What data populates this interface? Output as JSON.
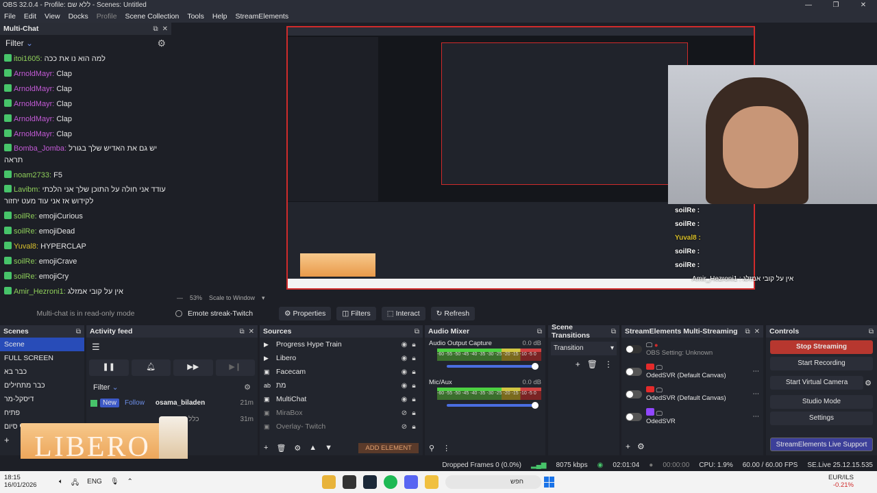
{
  "window": {
    "title": "OBS 32.0.4 - Profile: ללא שם - Scenes: Untitled"
  },
  "menu": [
    "File",
    "Edit",
    "View",
    "Docks",
    "Profile",
    "Scene Collection",
    "Tools",
    "Help",
    "StreamElements"
  ],
  "multichat": {
    "title": "Multi-Chat",
    "filter_label": "Filter",
    "readonly_note": "Multi-chat is in read-only mode",
    "messages": [
      {
        "user": "itoi1605:",
        "text": "למה הוא נו את ככה",
        "color": "#8fcf5a"
      },
      {
        "user": "ArnoldMayr:",
        "text": "Clap",
        "color": "#c35ad6"
      },
      {
        "user": "ArnoldMayr:",
        "text": "Clap",
        "color": "#c35ad6"
      },
      {
        "user": "ArnoldMayr:",
        "text": "Clap",
        "color": "#c35ad6"
      },
      {
        "user": "ArnoldMayr:",
        "text": "Clap",
        "color": "#c35ad6"
      },
      {
        "user": "ArnoldMayr:",
        "text": "Clap",
        "color": "#c35ad6"
      },
      {
        "user": "Bomba_Jomba:",
        "text": "יש גם את האדיש שלך בגורל תראה",
        "color": "#c35ad6"
      },
      {
        "user": "noam2733:",
        "text": "F5",
        "color": "#8fcf5a"
      },
      {
        "user": "Lavibm:",
        "text": "עודד אני חולה על התוכן שלך אני הלכתי לקידוש אז אני עוד מעט יחזור",
        "color": "#8fcf5a"
      },
      {
        "user": "soilRe:",
        "text": "emojiCurious",
        "color": "#8fcf5a"
      },
      {
        "user": "soilRe:",
        "text": "emojiDead",
        "color": "#8fcf5a"
      },
      {
        "user": "Yuval8:",
        "text": "HYPERCLAP",
        "color": "#d9c02c"
      },
      {
        "user": "soilRe:",
        "text": "emojiCrave",
        "color": "#8fcf5a"
      },
      {
        "user": "soilRe:",
        "text": "emojiCry",
        "color": "#8fcf5a"
      },
      {
        "user": "Amir_Hezroni1:",
        "text": "אין על קובי אמזלג",
        "color": "#8fcf5a"
      }
    ]
  },
  "preview": {
    "zoom": "53%",
    "scale_mode": "Scale to Window",
    "source_name": "Emote streak-Twitch",
    "buttons": {
      "properties": "Properties",
      "filters": "Filters",
      "interact": "Interact",
      "refresh": "Refresh"
    }
  },
  "overlay_chat": {
    "lines": [
      "soilRe :",
      "soilRe :",
      "Yuval8 :",
      "soilRe :",
      "soilRe :"
    ],
    "last": "Amir_Hezroni1 : אין על קובי אמזלג"
  },
  "scenes": {
    "title": "Scenes",
    "items": [
      "Scene",
      "FULL SCREEN",
      "כבר בא",
      "כבר מתחילים",
      "דיסקל-מר",
      "פתיח",
      "סוף סיום"
    ]
  },
  "activity": {
    "title": "Activity feed",
    "filter_label": "Filter",
    "event": {
      "tag_new": "New",
      "tag_type": "Follow",
      "user": "osama_biladen",
      "time": "21m"
    },
    "event2_time": "31m",
    "event2_text": "כלל שאינ"
  },
  "sources": {
    "title": "Sources",
    "items": [
      {
        "name": "Progress Hype Train",
        "dim": false
      },
      {
        "name": "Libero",
        "dim": false
      },
      {
        "name": "Facecam",
        "dim": false
      },
      {
        "name": "מת",
        "dim": false
      },
      {
        "name": "MultiChat",
        "dim": false
      },
      {
        "name": "MiraBox",
        "dim": true
      },
      {
        "name": "Overlay- Twitch",
        "dim": true
      }
    ],
    "add_element": "ADD ELEMENT"
  },
  "audio": {
    "title": "Audio Mixer",
    "channels": [
      {
        "name": "Audio Output Capture",
        "db": "0.0 dB",
        "scale": "-60 -55 -50 -45 -40 -35 -30 -25 -20 -15 -10 -5 0"
      },
      {
        "name": "Mic/Aux",
        "db": "0.0 dB",
        "scale": "-60 -55 -50 -45 -40 -35 -30 -25 -20 -15 -10 -5 0"
      }
    ]
  },
  "transitions": {
    "title": "Scene Transitions",
    "selected": "Transition"
  },
  "multistream": {
    "title": "StreamElements Multi-Streaming",
    "rows": [
      {
        "label": "OBS Setting: Unknown",
        "platform": "obs"
      },
      {
        "label": "OdedSVR (Default Canvas)",
        "platform": "youtube"
      },
      {
        "label": "OdedSVR (Default Canvas)",
        "platform": "youtube"
      },
      {
        "label": "OdedSVR",
        "platform": "twitch"
      }
    ]
  },
  "controls": {
    "title": "Controls",
    "buttons": [
      "Stop Streaming",
      "Start Recording",
      "Start Virtual Camera",
      "Studio Mode",
      "Settings"
    ],
    "live_support": "StreamElements Live Support"
  },
  "status": {
    "dropped": "Dropped Frames 0 (0.0%)",
    "bitrate": "8075 kbps",
    "stream_time": "02:01:04",
    "rec_time": "00:00:00",
    "cpu": "CPU: 1.9%",
    "fps": "60.00 / 60.00 FPS",
    "version": "SE.Live 25.12.15.535"
  },
  "taskbar": {
    "time": "18:15",
    "date": "16/01/2026",
    "lang": "ENG",
    "search": "חפש",
    "currency": "EUR/ILS",
    "change": "-0.21%"
  },
  "overlay_brand": "LIBERO"
}
